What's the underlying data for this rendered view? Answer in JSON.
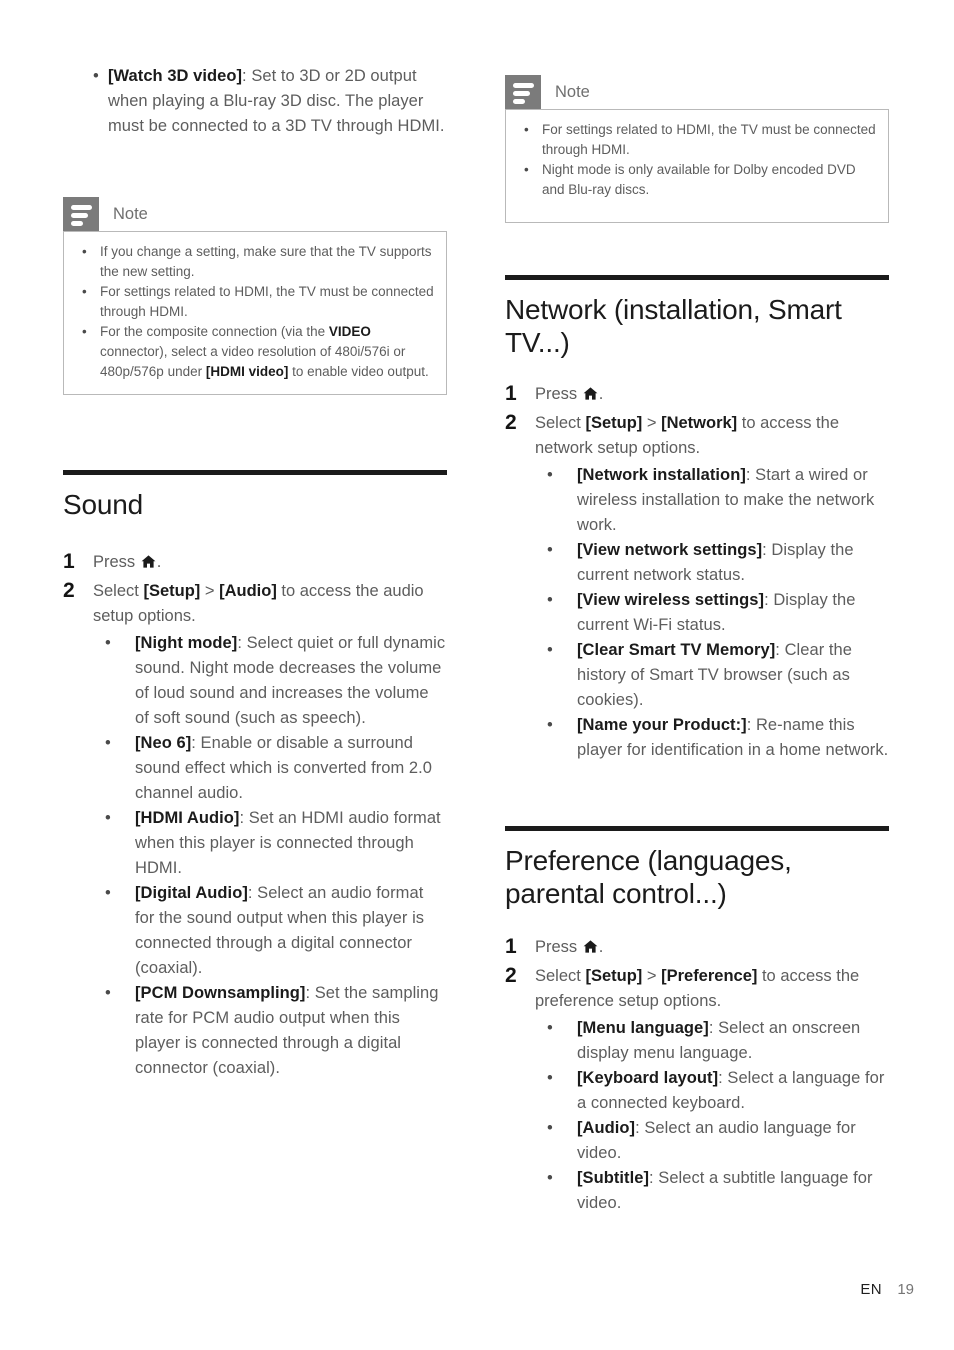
{
  "document": {
    "footer": {
      "language_code": "EN",
      "page_number": "19"
    },
    "note_label": "Note",
    "home_icon_name": "home-icon"
  },
  "left_column": {
    "top_bullets": [
      {
        "label": "[Watch 3D video]",
        "text": ": Set to 3D or 2D output when playing a Blu-ray 3D disc. The player must be connected to a 3D TV through HDMI."
      }
    ],
    "note": {
      "title": "Note",
      "items": [
        "If you change a setting, make sure that the TV supports the new setting.",
        "For settings related to HDMI, the TV must be connected through HDMI.",
        "For the composite connection (via the VIDEO connector), select a video resolution of 480i/576i or 480p/576p under [HDMI video] to enable video output."
      ],
      "items_rich": [
        {
          "pre": "If you change a setting, make sure that the TV supports the new setting.",
          "bold": "",
          "post": ""
        },
        {
          "pre": "For settings related to HDMI, the TV must be connected through HDMI.",
          "bold": "",
          "post": ""
        },
        {
          "pre": "For the composite connection (via the ",
          "bold": "VIDEO",
          "mid": " connector), select a video resolution of 480i/576i or 480p/576p under ",
          "bold2": "[HDMI video]",
          "post": " to enable video output."
        }
      ]
    },
    "section": {
      "title": "Sound",
      "steps": [
        {
          "num": "1",
          "pre": "Press ",
          "icon": "home-icon",
          "post": "."
        },
        {
          "num": "2",
          "pre": "Select ",
          "b1": "[Setup]",
          "mid": " > ",
          "b2": "[Audio]",
          "post": " to access the audio setup options."
        }
      ],
      "bullets": [
        {
          "label": "[Night mode]",
          "text": ": Select quiet or full dynamic sound. Night mode decreases the volume of loud sound and increases the volume of soft sound (such as speech)."
        },
        {
          "label": "[Neo 6]",
          "text": ": Enable or disable a surround sound effect which is converted from 2.0 channel audio."
        },
        {
          "label": "[HDMI Audio]",
          "text": ": Set an HDMI audio format when this player is connected through HDMI."
        },
        {
          "label": "[Digital Audio]",
          "text": ": Select an audio format for the sound output when this player is connected through a digital connector (coaxial)."
        },
        {
          "label": "[PCM Downsampling]",
          "text": ": Set the sampling rate for PCM audio output when this player is connected through a digital connector (coaxial)."
        }
      ]
    }
  },
  "right_column": {
    "note": {
      "title": "Note",
      "items": [
        "For settings related to HDMI, the TV must be connected through HDMI.",
        "Night mode is only available for Dolby encoded DVD and Blu-ray discs."
      ]
    },
    "section_network": {
      "title": "Network (installation, Smart TV...)",
      "steps": [
        {
          "num": "1",
          "pre": "Press ",
          "icon": "home-icon",
          "post": "."
        },
        {
          "num": "2",
          "pre": "Select ",
          "b1": "[Setup]",
          "mid": " > ",
          "b2": "[Network]",
          "post": " to access the network setup options."
        }
      ],
      "bullets": [
        {
          "label": "[Network installation]",
          "text": ": Start a wired or wireless installation to make the network work."
        },
        {
          "label": "[View network settings]",
          "text": ": Display the current network status."
        },
        {
          "label": "[View wireless settings]",
          "text": ": Display the current Wi-Fi status."
        },
        {
          "label": "[Clear Smart TV Memory]",
          "text": ": Clear the history of Smart TV browser (such as cookies)."
        },
        {
          "label": "[Name your Product:]",
          "text": ": Re-name this player for identification in a home network."
        }
      ]
    },
    "section_preference": {
      "title": "Preference (languages, parental control...)",
      "steps": [
        {
          "num": "1",
          "pre": "Press ",
          "icon": "home-icon",
          "post": "."
        },
        {
          "num": "2",
          "pre": "Select ",
          "b1": "[Setup]",
          "mid": " > ",
          "b2": "[Preference]",
          "post": " to access the preference setup options."
        }
      ],
      "bullets": [
        {
          "label": "[Menu language]",
          "text": ": Select an onscreen display menu language."
        },
        {
          "label": "[Keyboard layout]",
          "text": ": Select a language for a connected keyboard."
        },
        {
          "label": "[Audio]",
          "text": ": Select an audio language for video."
        },
        {
          "label": "[Subtitle]",
          "text": ": Select a subtitle language for video."
        }
      ]
    }
  },
  "colors": {
    "body_text": "#5d5d5d",
    "heading_text": "#1b1b1b",
    "rule": "#1b1b1b",
    "note_icon_bg": "#7b7b7b",
    "note_border": "#b9b9b9"
  }
}
